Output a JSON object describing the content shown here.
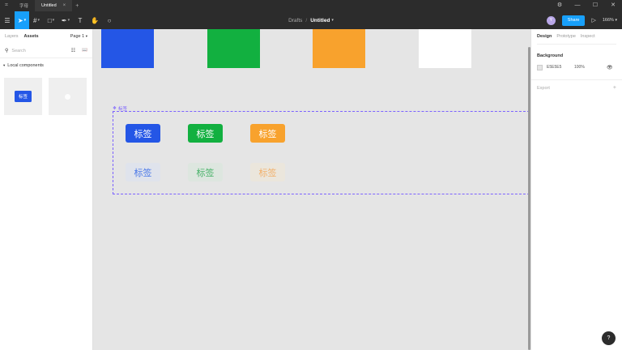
{
  "titlebar": {
    "logo_glyph": "⌗",
    "tabs": [
      {
        "label": "字母",
        "active": false
      },
      {
        "label": "Untitled",
        "active": true
      }
    ],
    "close_glyph": "×",
    "new_tab_glyph": "+",
    "window_controls": [
      "⚙",
      "—",
      "☐",
      "✕"
    ]
  },
  "toolbar": {
    "menu_glyph": "☰",
    "tools": [
      {
        "name": "move-tool",
        "glyph": "➤",
        "selected": true
      },
      {
        "name": "frame-tool",
        "glyph": "#",
        "selected": false
      },
      {
        "name": "shape-tool",
        "glyph": "□",
        "selected": false
      },
      {
        "name": "pen-tool",
        "glyph": "✒",
        "selected": false
      },
      {
        "name": "text-tool",
        "glyph": "T",
        "selected": false
      },
      {
        "name": "hand-tool",
        "glyph": "✋",
        "selected": false
      },
      {
        "name": "comment-tool",
        "glyph": "○",
        "selected": false
      }
    ],
    "caret_glyph": "▾",
    "breadcrumb_parent": "Drafts",
    "breadcrumb_sep": "/",
    "file_name": "Untitled",
    "avatar_letter": "Y",
    "share_label": "Share",
    "play_glyph": "▷",
    "zoom_label": "166%"
  },
  "left_panel": {
    "tabs": [
      "Layers",
      "Assets"
    ],
    "active_tab": "Assets",
    "page_label": "Page 1",
    "search_placeholder": "Search",
    "search_glyph": "⚲",
    "list_view_glyph": "☷",
    "book_glyph": "📖",
    "section_arrow": "▾",
    "section_label": "Local components",
    "components": [
      {
        "type": "tag",
        "label": "标签"
      },
      {
        "type": "empty"
      }
    ]
  },
  "canvas": {
    "swatches": [
      {
        "color": "#2456e6"
      },
      {
        "color": "#12b040"
      },
      {
        "color": "#f8a22d"
      },
      {
        "color": "#ffffff"
      }
    ],
    "frame_icon": "❖",
    "frame_label": "标签",
    "tags": [
      {
        "label": "标签",
        "bg": "#2456e6",
        "fg": "#ffffff"
      },
      {
        "label": "标签",
        "bg": "#12b040",
        "fg": "#ffffff"
      },
      {
        "label": "标签",
        "bg": "#f8a22d",
        "fg": "#ffffff"
      },
      {
        "label": "标签",
        "bg": "#dfe3ec",
        "fg": "#4a78e8"
      },
      {
        "label": "标签",
        "bg": "#dde6df",
        "fg": "#47b268"
      },
      {
        "label": "标签",
        "bg": "#ebe6dc",
        "fg": "#f2b06a"
      }
    ]
  },
  "right_panel": {
    "tabs": [
      "Design",
      "Prototype",
      "Inspect"
    ],
    "active_tab": "Design",
    "background_title": "Background",
    "bg_hex": "E5E5E5",
    "bg_opacity": "100%",
    "eye_glyph": "👁",
    "export_label": "Export",
    "export_plus": "+"
  },
  "help_glyph": "?"
}
